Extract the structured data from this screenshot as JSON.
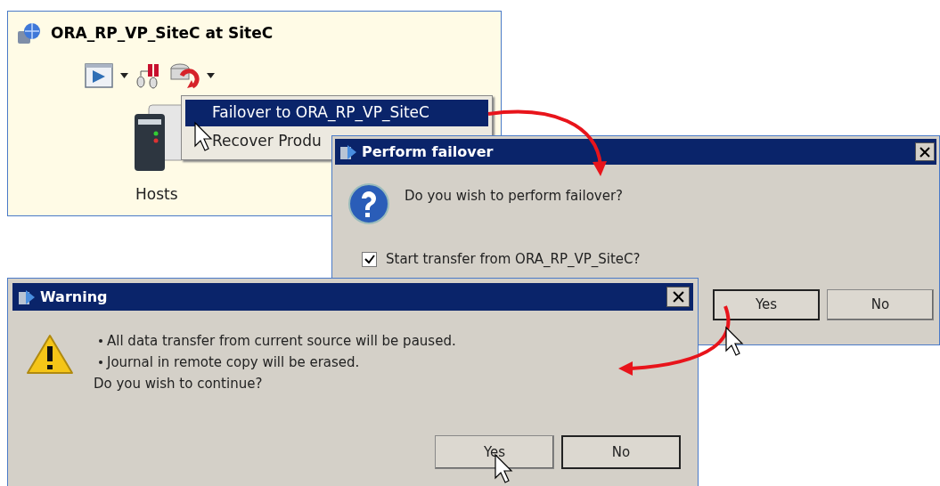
{
  "console": {
    "title": "ORA_RP_VP_SiteC at SiteC",
    "context_menu": {
      "items": [
        {
          "label": "Failover to ORA_RP_VP_SiteC",
          "selected": true
        },
        {
          "label": "Recover Produ",
          "selected": false
        }
      ]
    },
    "hosts_label": "Hosts"
  },
  "failover_dialog": {
    "title": "Perform failover",
    "message": "Do you wish to perform failover?",
    "checkbox": {
      "label": "Start transfer from ORA_RP_VP_SiteC?",
      "checked": true
    },
    "buttons": [
      {
        "label": "Yes",
        "default": true
      },
      {
        "label": "No",
        "default": false
      }
    ]
  },
  "warning_dialog": {
    "title": "Warning",
    "bullets": [
      "All data transfer from current source will be paused.",
      "Journal in remote copy will be erased."
    ],
    "message": "Do you wish to continue?",
    "buttons": [
      {
        "label": "Yes",
        "default": false
      },
      {
        "label": "No",
        "default": true
      }
    ]
  }
}
